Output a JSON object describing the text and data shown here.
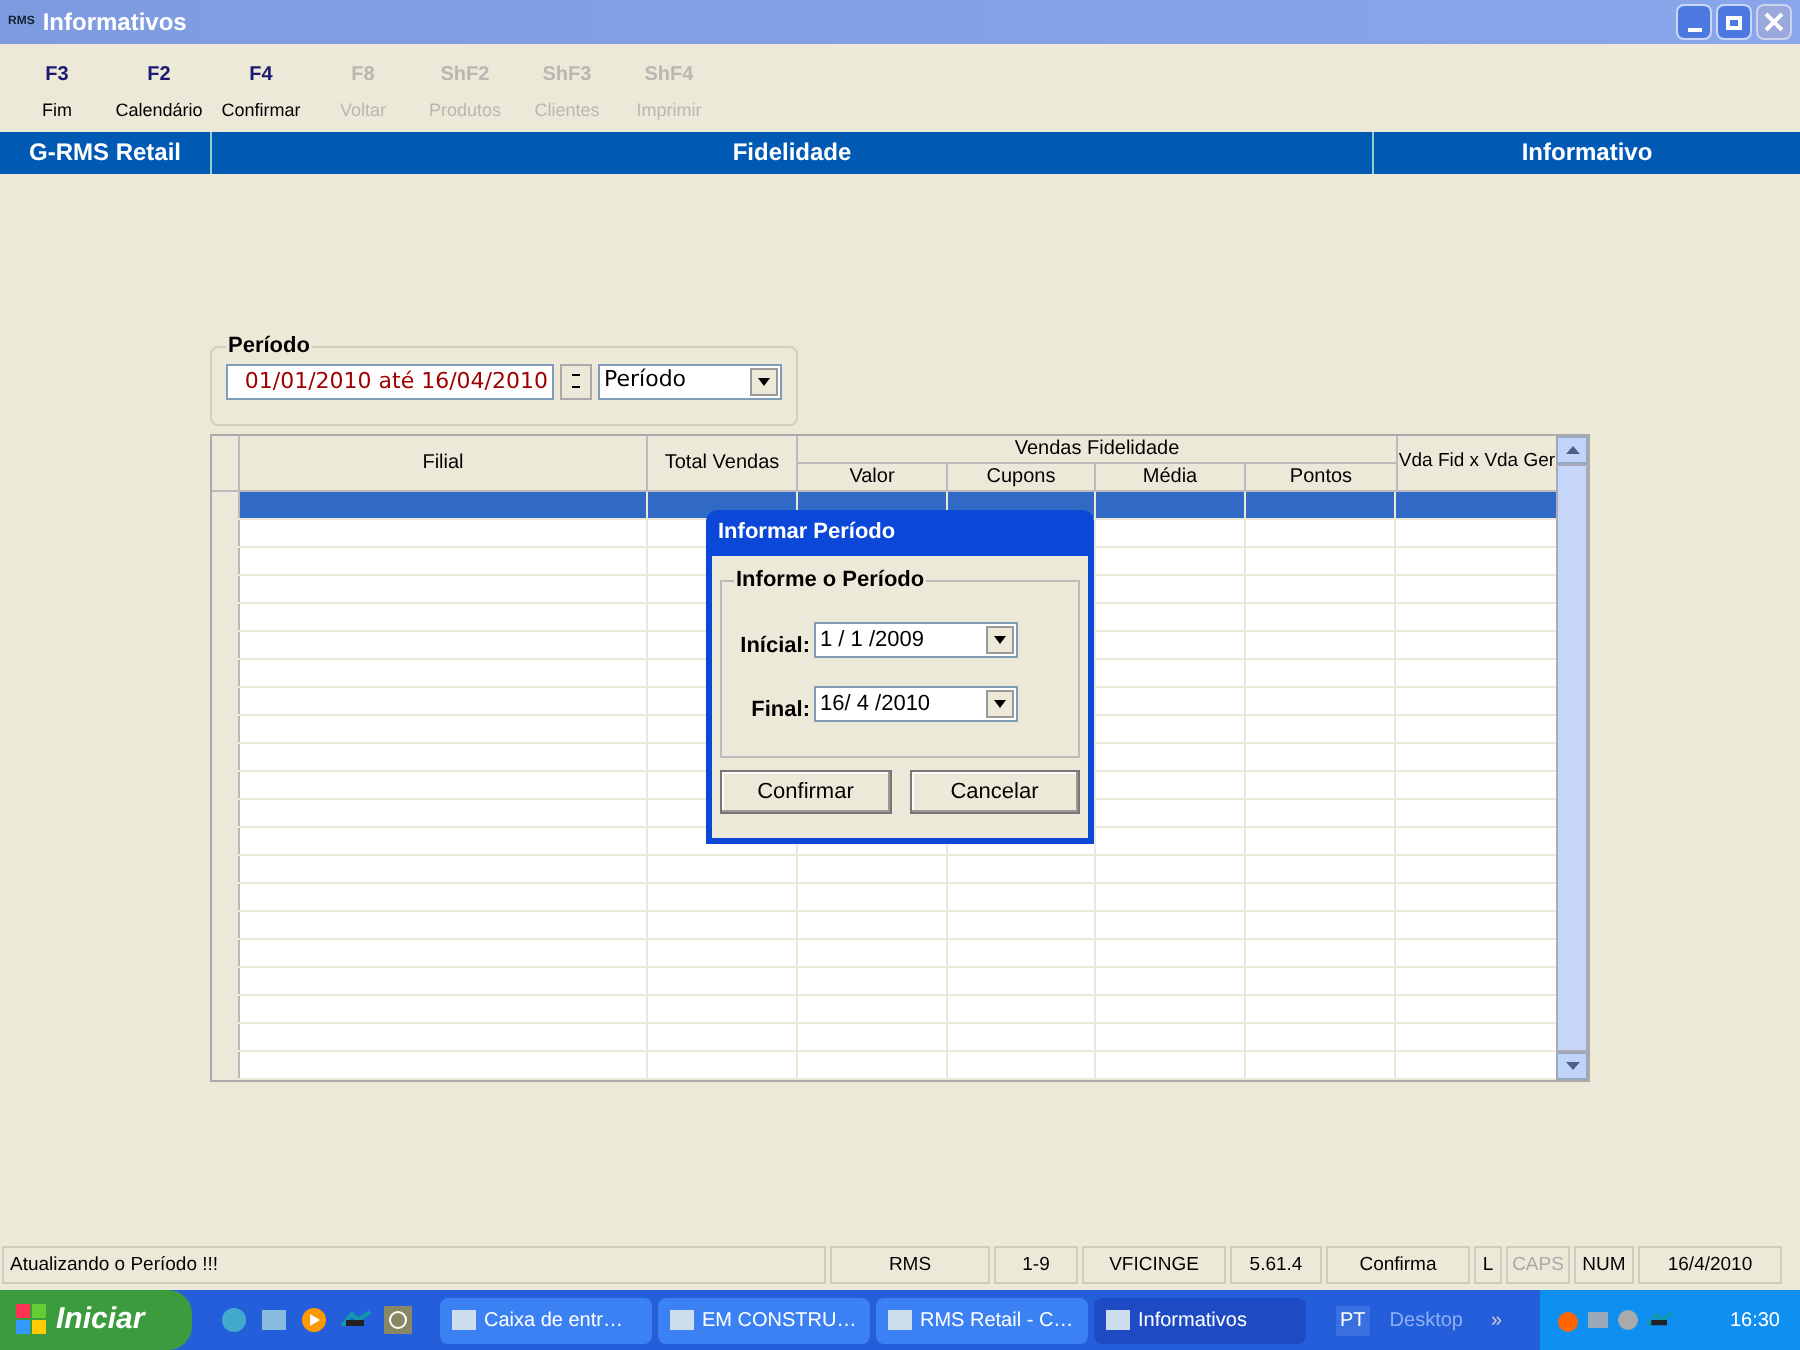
{
  "window": {
    "title": "Informativos",
    "app_icon": "RMS"
  },
  "toolbar": [
    {
      "key": "F3",
      "label": "Fim",
      "disabled": false
    },
    {
      "key": "F2",
      "label": "Calendário",
      "disabled": false
    },
    {
      "key": "F4",
      "label": "Confirmar",
      "disabled": false
    },
    {
      "key": "F8",
      "label": "Voltar",
      "disabled": true
    },
    {
      "key": "ShF2",
      "label": "Produtos",
      "disabled": true
    },
    {
      "key": "ShF3",
      "label": "Clientes",
      "disabled": true
    },
    {
      "key": "ShF4",
      "label": "Imprimir",
      "disabled": true
    }
  ],
  "header_bar": [
    "G-RMS Retail",
    "Fidelidade",
    "Informativo"
  ],
  "period": {
    "legend": "Período",
    "range": "01/01/2010 até 16/04/2010",
    "mode": "Período"
  },
  "table": {
    "columns": [
      "Filial",
      "Total Vendas"
    ],
    "group": "Vendas Fidelidade",
    "group_columns": [
      "Valor",
      "Cupons",
      "Média",
      "Pontos"
    ],
    "last_column": "Vda Fid x Vda Ger",
    "rows": [
      {
        "selected": true
      },
      {
        "selected": false
      },
      {
        "selected": false
      },
      {
        "selected": false
      },
      {
        "selected": false
      },
      {
        "selected": false
      },
      {
        "selected": false
      },
      {
        "selected": false
      },
      {
        "selected": false
      },
      {
        "selected": false
      },
      {
        "selected": false
      },
      {
        "selected": false
      },
      {
        "selected": false
      },
      {
        "selected": false
      },
      {
        "selected": false
      },
      {
        "selected": false
      },
      {
        "selected": false
      },
      {
        "selected": false
      },
      {
        "selected": false
      },
      {
        "selected": false
      },
      {
        "selected": false
      }
    ]
  },
  "dialog": {
    "title": "Informar Período",
    "group": "Informe o Período",
    "fields": [
      {
        "label": "Inícial:",
        "value": "1 / 1 /2009"
      },
      {
        "label": "Final:",
        "value": "16/ 4 /2010"
      }
    ],
    "buttons": [
      "Confirmar",
      "Cancelar"
    ]
  },
  "status_bar": [
    {
      "text": "Atualizando o Período !!!",
      "disabled": false
    },
    {
      "text": "RMS",
      "disabled": false
    },
    {
      "text": "1-9",
      "disabled": false
    },
    {
      "text": "VFICINGE",
      "disabled": false
    },
    {
      "text": "5.61.4",
      "disabled": false
    },
    {
      "text": "Confirma",
      "disabled": false
    },
    {
      "text": "L",
      "disabled": false
    },
    {
      "text": "CAPS",
      "disabled": true
    },
    {
      "text": "NUM",
      "disabled": false
    },
    {
      "text": "16/4/2010",
      "disabled": false
    }
  ],
  "taskbar": {
    "start": "Iniciar",
    "tasks": [
      {
        "label": "Caixa de entr…",
        "selected": false
      },
      {
        "label": "EM CONSTRU…",
        "selected": false
      },
      {
        "label": "RMS Retail - C…",
        "selected": false
      },
      {
        "label": "Informativos",
        "selected": true
      }
    ],
    "language": "PT",
    "desktop": "Desktop",
    "chevron": "»",
    "clock": "16:30"
  }
}
